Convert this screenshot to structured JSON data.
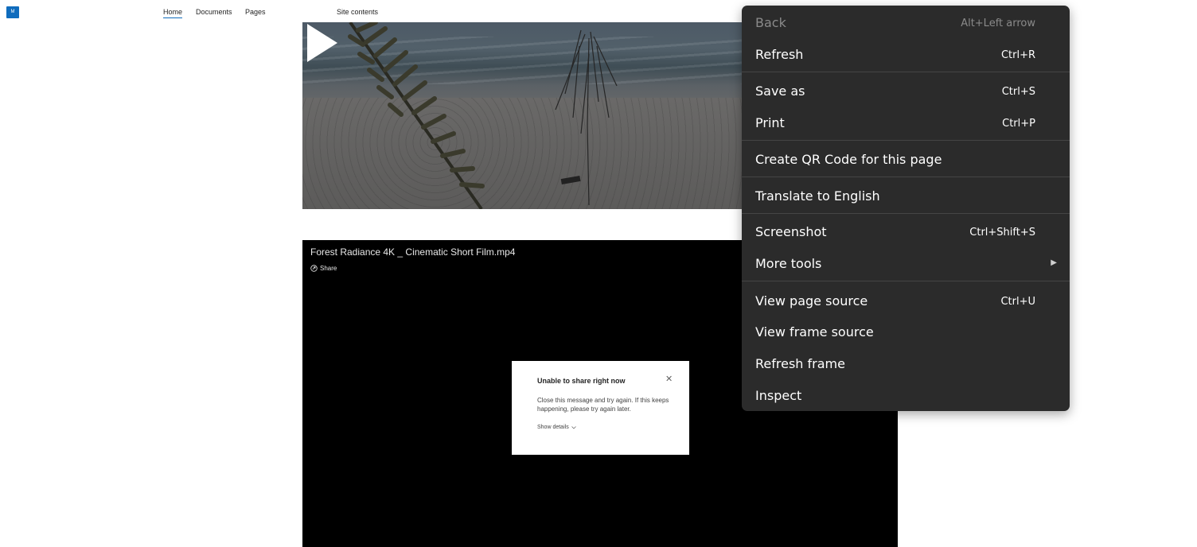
{
  "app": {
    "icon_text": "M"
  },
  "nav": {
    "items": [
      {
        "label": "Home"
      },
      {
        "label": "Documents"
      },
      {
        "label": "Pages"
      },
      {
        "label": "Site contents"
      }
    ]
  },
  "video2": {
    "title": "Forest Radiance 4K _ Cinematic Short Film.mp4",
    "share_label": "Share"
  },
  "dialog": {
    "title": "Unable to share right now",
    "close_icon": "close-icon",
    "body": "Close this message and try again. If this keeps happening, please try again later.",
    "details_label": "Show details"
  },
  "context_menu": {
    "items": [
      {
        "label": "Back",
        "shortcut": "Alt+Left arrow",
        "disabled": true
      },
      {
        "label": "Refresh",
        "shortcut": "Ctrl+R"
      },
      {
        "label": "Save as",
        "shortcut": "Ctrl+S"
      },
      {
        "label": "Print",
        "shortcut": "Ctrl+P"
      },
      {
        "label": "Create QR Code for this page",
        "shortcut": ""
      },
      {
        "label": "Translate to English",
        "shortcut": ""
      },
      {
        "label": "Screenshot",
        "shortcut": "Ctrl+Shift+S"
      },
      {
        "label": "More tools",
        "shortcut": "",
        "submenu": true
      },
      {
        "label": "View page source",
        "shortcut": "Ctrl+U"
      },
      {
        "label": "View frame source",
        "shortcut": ""
      },
      {
        "label": "Refresh frame",
        "shortcut": ""
      },
      {
        "label": "Inspect",
        "shortcut": ""
      }
    ]
  },
  "colors": {
    "accent": "#0f6cbd",
    "menu_bg": "#2b2b2b",
    "video_bg": "#000000"
  }
}
